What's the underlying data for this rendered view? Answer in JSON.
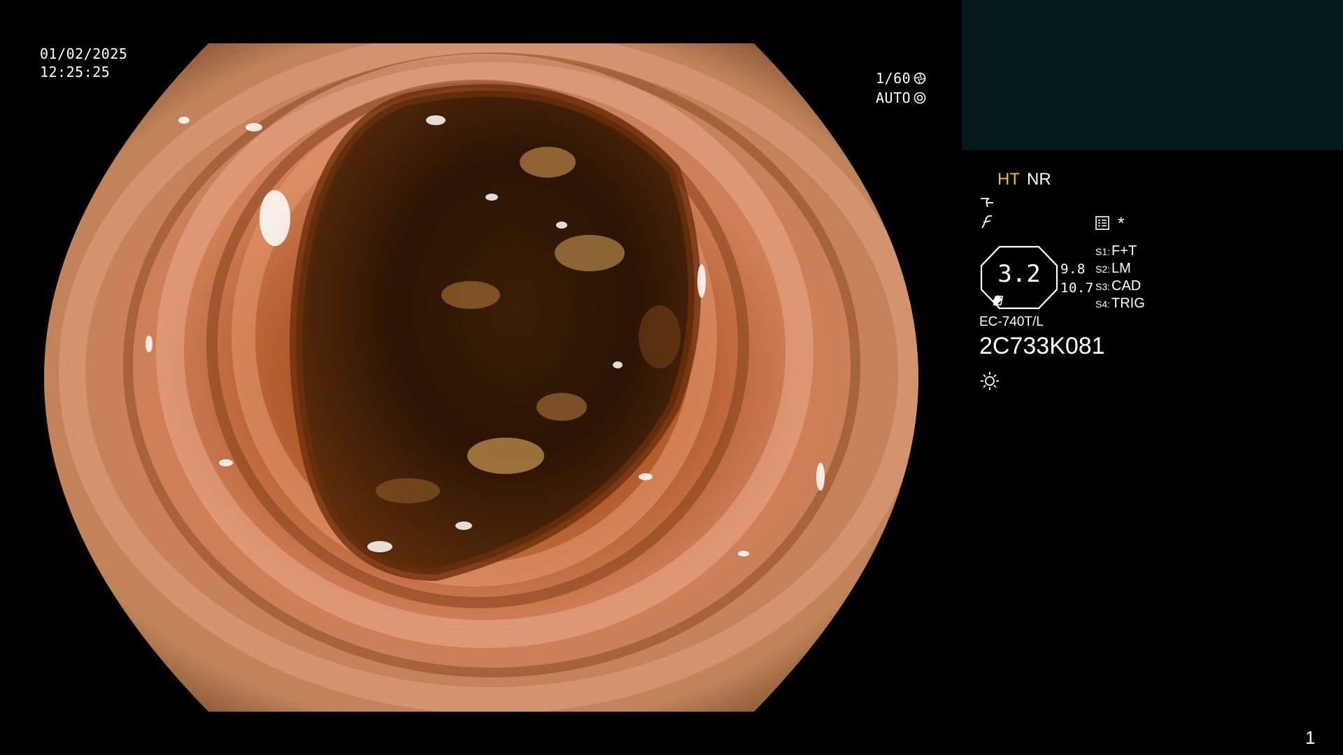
{
  "overlay": {
    "date": "01/02/2025",
    "time": "12:25:25",
    "shutter": "1/60",
    "iris": "AUTO",
    "shutter_icon": "shutter-icon",
    "iris_icon": "iris-icon"
  },
  "status_panel": {
    "ht_label": "HT",
    "nr_label": "NR",
    "ht_color": "#f0c020",
    "pip_background": "#031a1a",
    "zoom_value": "3.2",
    "zoom_secondary_a": "9.8",
    "zoom_secondary_b": "10.7",
    "asterisk": "*",
    "switches": [
      {
        "key": "S1:",
        "value": "F+T"
      },
      {
        "key": "S2:",
        "value": "LM"
      },
      {
        "key": "S3:",
        "value": "CAD"
      },
      {
        "key": "S4:",
        "value": "TRIG"
      }
    ],
    "scope_model": "EC-740T/L",
    "scope_serial": "2C733K081"
  },
  "page_number": "1"
}
